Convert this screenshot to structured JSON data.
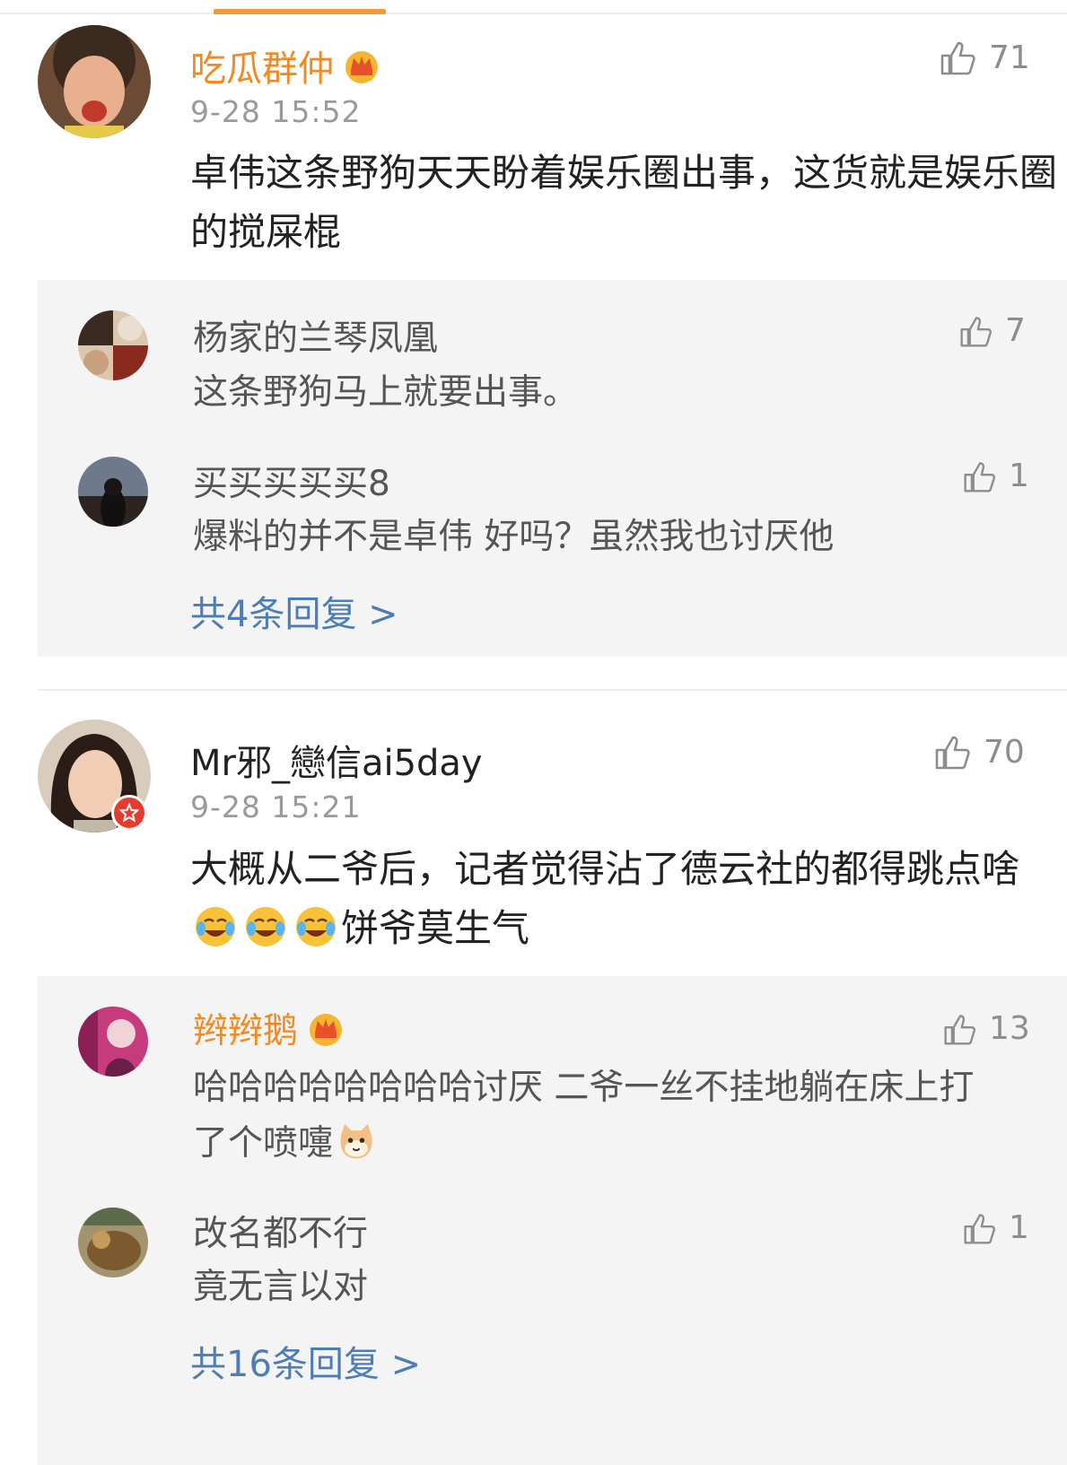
{
  "colors": {
    "vip_name": "#f08a24",
    "link": "#4d7db8",
    "tab_indicator": "#f29a38",
    "reply_bg": "#f4f4f4"
  },
  "comments": [
    {
      "username": "吃瓜群仲",
      "time": "9-28 15:52",
      "likes": "71",
      "text": "卓伟这条野狗天天盼着娱乐圈出事，这货就是娱乐圈的搅屎棍",
      "replies": [
        {
          "username": "杨家的兰琴凤凰",
          "likes": "7",
          "text": "这条野狗马上就要出事。"
        },
        {
          "username": "买买买买买8",
          "likes": "1",
          "text": "爆料的并不是卓伟 好吗？虽然我也讨厌他"
        }
      ],
      "more_replies": "共4条回复 >"
    },
    {
      "username": "Mr邪_戀信ai5day",
      "time": "9-28 15:21",
      "likes": "70",
      "text_a": "大概从二爷后，记者觉得沾了德云社的都得跳点啥",
      "text_b": "饼爷莫生气",
      "replies": [
        {
          "username": "辫辫鹅",
          "likes": "13",
          "text": "哈哈哈哈哈哈哈哈讨厌 二爷一丝不挂地躺在床上打了个喷嚏"
        },
        {
          "username": "改名都不行",
          "likes": "1",
          "text": "竟无言以对"
        }
      ],
      "more_replies": "共16条回复 >"
    }
  ],
  "icons": [
    "thumbs-up-icon",
    "crown-icon",
    "laugh-cry-emoji",
    "cat-emoji",
    "vip-badge-icon"
  ]
}
